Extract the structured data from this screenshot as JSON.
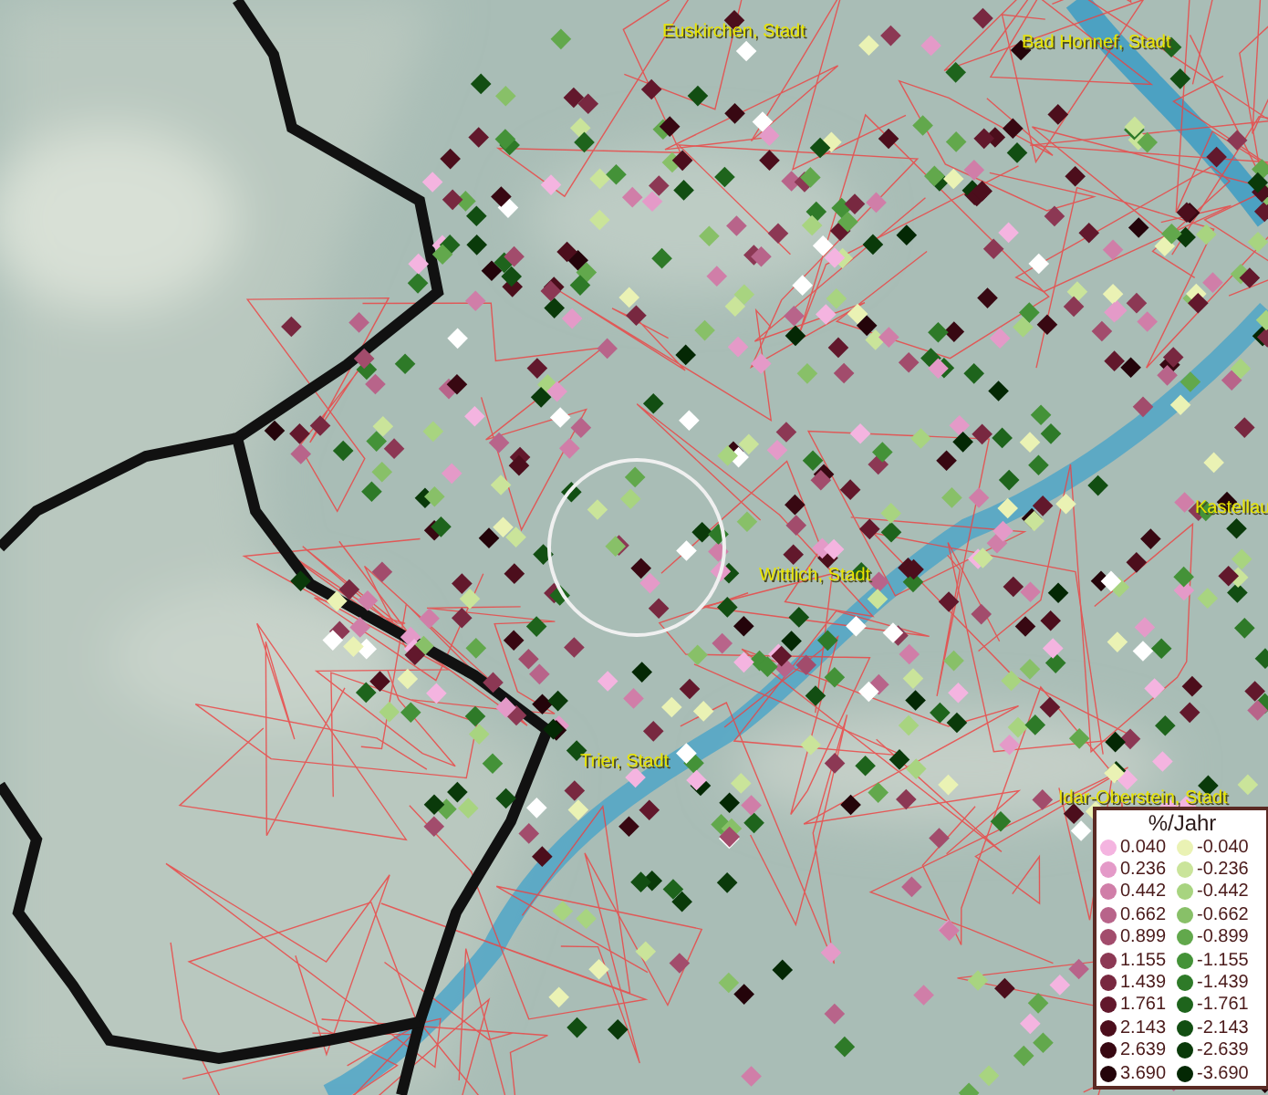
{
  "map": {
    "place_labels": [
      {
        "text": "Euskirchen, Stadt"
      },
      {
        "text": "Bad Honnef, Stadt"
      },
      {
        "text": "Kastellau"
      },
      {
        "text": "Wittlich, Stadt"
      },
      {
        "text": "Trier, Stadt"
      },
      {
        "text": "Idar-Oberstein, Stadt"
      }
    ]
  },
  "legend": {
    "title": "%/Jahr",
    "positive": [
      {
        "value": "0.040",
        "color": "#f4b4e0"
      },
      {
        "value": "0.236",
        "color": "#e49ac8"
      },
      {
        "value": "0.442",
        "color": "#d07ea8"
      },
      {
        "value": "0.662",
        "color": "#b8648a"
      },
      {
        "value": "0.899",
        "color": "#a24c6c"
      },
      {
        "value": "1.155",
        "color": "#8c3854"
      },
      {
        "value": "1.439",
        "color": "#782840"
      },
      {
        "value": "1.761",
        "color": "#62182c"
      },
      {
        "value": "2.143",
        "color": "#4c0e1c"
      },
      {
        "value": "2.639",
        "color": "#380812"
      },
      {
        "value": "3.690",
        "color": "#24040a"
      }
    ],
    "negative": [
      {
        "value": "-0.040",
        "color": "#eaf2b4"
      },
      {
        "value": "-0.236",
        "color": "#cae49a"
      },
      {
        "value": "-0.442",
        "color": "#a8d480"
      },
      {
        "value": "-0.662",
        "color": "#88c068"
      },
      {
        "value": "-0.899",
        "color": "#62a84c"
      },
      {
        "value": "-1.155",
        "color": "#449238"
      },
      {
        "value": "-1.439",
        "color": "#2e7a28"
      },
      {
        "value": "-1.761",
        "color": "#1e641c"
      },
      {
        "value": "-2.143",
        "color": "#124e12"
      },
      {
        "value": "-2.639",
        "color": "#0a3a0a"
      },
      {
        "value": "-3.690",
        "color": "#042804"
      }
    ]
  }
}
